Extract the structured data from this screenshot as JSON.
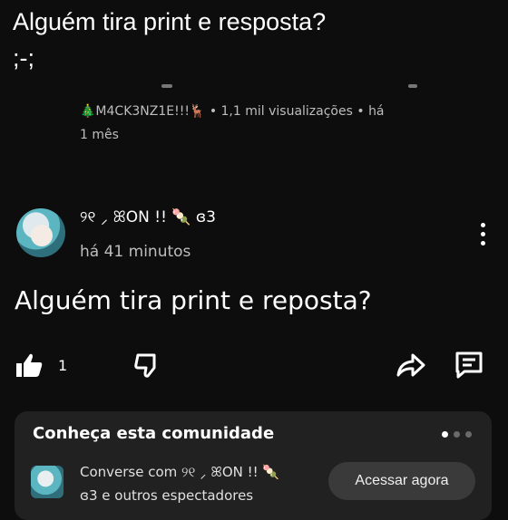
{
  "caption": {
    "line1": "Alguém tira print e resposta?",
    "line2": ";-;"
  },
  "previous_comment": {
    "meta_line1": "🎄M4CK3NZ1E!!!🦌 • 1,1 mil visualizações • há",
    "meta_line2": "1 mês"
  },
  "comment": {
    "username": "୨୧ ⸝ ꕤON !! 🍡 ɞ3",
    "time": "há 41 minutos",
    "text": "Alguém tira print e reposta?",
    "like_count": "1"
  },
  "community_card": {
    "title": "Conheça esta comunidade",
    "text_line1": "Converse com ୨୧ ⸝ ꕤON !! 🍡",
    "text_line2": "ɞ3 e outros espectadores",
    "button_label": "Acessar agora"
  },
  "icons": {
    "like": "thumbs-up-icon",
    "dislike": "thumbs-down-icon",
    "share": "share-icon",
    "reply": "comment-icon",
    "more": "more-vertical-icon"
  }
}
